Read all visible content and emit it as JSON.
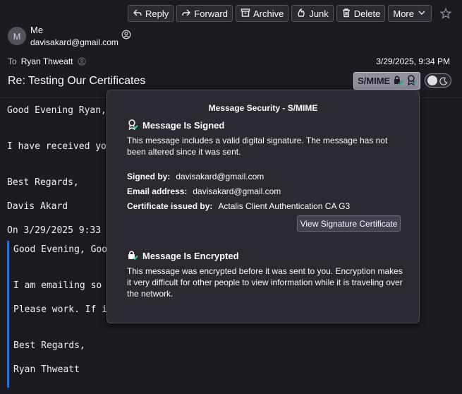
{
  "toolbar": {
    "reply": "Reply",
    "forward": "Forward",
    "archive": "Archive",
    "junk": "Junk",
    "delete": "Delete",
    "more": "More"
  },
  "sender": {
    "avatar_initial": "M",
    "name": "Me",
    "email": "davisakard@gmail.com"
  },
  "recipient": {
    "label": "To",
    "name": "Ryan Thweatt"
  },
  "date": "3/29/2025, 9:34 PM",
  "subject": "Re: Testing Our Certificates",
  "smime_label": "S/MIME",
  "body": {
    "line1": "Good Evening Ryan,",
    "line2": "I have received you",
    "line3": "Best Regards,",
    "line4": "Davis Akard",
    "line5": "On 3/29/2025 9:33 ",
    "quote1": "Good Evening, Good",
    "quote2": "I am emailing so ",
    "quote3": "Please work. If i",
    "quote4": "Best Regards,",
    "quote5": "Ryan Thweatt"
  },
  "popup": {
    "title": "Message Security - S/MIME",
    "signed_heading": "Message Is Signed",
    "signed_desc": "This message includes a valid digital signature. The message has not been altered since it was sent.",
    "signed_by_label": "Signed by:",
    "signed_by_value": "davisakard@gmail.com",
    "email_label": "Email address:",
    "email_value": "davisakard@gmail.com",
    "issuer_label": "Certificate issued by:",
    "issuer_value": "Actalis Client Authentication CA G3",
    "view_cert_button": "View Signature Certificate",
    "encrypted_heading": "Message Is Encrypted",
    "encrypted_desc": "This message was encrypted before it was sent to you. Encryption makes it very difficult for other people to view information while it is traveling over the network."
  },
  "colors": {
    "background": "#1c1b22",
    "popup_bg": "#2b2a33",
    "quote_bar": "#2a6fd1",
    "check_green": "#3fe1b0"
  },
  "icons": [
    "reply-icon",
    "forward-icon",
    "archive-icon",
    "junk-icon",
    "delete-icon",
    "chevron-down-icon",
    "star-icon",
    "contact-icon",
    "lock-icon",
    "certificate-icon",
    "moon-icon"
  ]
}
